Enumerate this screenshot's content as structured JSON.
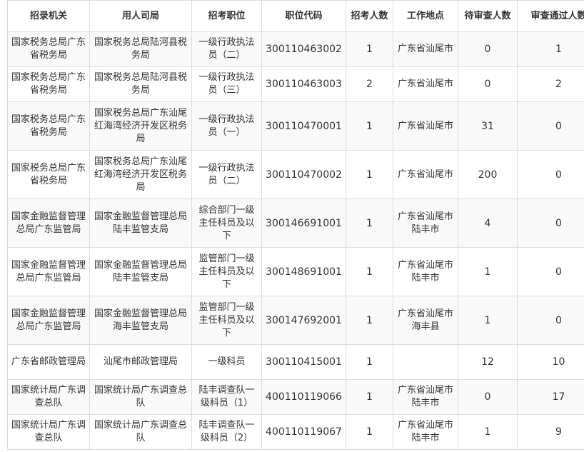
{
  "table": {
    "headers": [
      "招录机关",
      "用人司局",
      "招考职位",
      "职位代码",
      "招考人数",
      "工作地点",
      "待审查人数",
      "审查通过人数"
    ],
    "rows": [
      [
        "国家税务总局广东省税务局",
        "国家税务总局陆河县税务局",
        "一级行政执法员（二）",
        "300110463002",
        "1",
        "广东省汕尾市",
        "0",
        "1"
      ],
      [
        "国家税务总局广东省税务局",
        "国家税务总局陆河县税务局",
        "一级行政执法员（三）",
        "300110463003",
        "2",
        "广东省汕尾市",
        "0",
        "2"
      ],
      [
        "国家税务总局广东省税务局",
        "国家税务总局广东汕尾红海湾经济开发区税务局",
        "一级行政执法员（一）",
        "300110470001",
        "1",
        "广东省汕尾市",
        "31",
        "0"
      ],
      [
        "国家税务总局广东省税务局",
        "国家税务总局广东汕尾红海湾经济开发区税务局",
        "一级行政执法员（二）",
        "300110470002",
        "1",
        "广东省汕尾市",
        "200",
        "0"
      ],
      [
        "国家金融监督管理总局广东监管局",
        "国家金融监督管理总局陆丰监管支局",
        "综合部门一级主任科员及以下",
        "300146691001",
        "1",
        "广东省汕尾市陆丰市",
        "4",
        "0"
      ],
      [
        "国家金融监督管理总局广东监管局",
        "国家金融监督管理总局陆丰监管支局",
        "监管部门一级主任科员及以下",
        "300148691001",
        "1",
        "广东省汕尾市陆丰市",
        "1",
        "0"
      ],
      [
        "国家金融监督管理总局广东监管局",
        "国家金融监督管理总局海丰监管支局",
        "监管部门一级主任科员及以下",
        "300147692001",
        "1",
        "广东省汕尾市海丰县",
        "1",
        "0"
      ],
      [
        "广东省邮政管理局",
        "汕尾市邮政管理局",
        "一级科员",
        "300110415001",
        "1",
        "",
        "12",
        "10"
      ],
      [
        "国家统计局广东调查总队",
        "国家统计局广东调查总队",
        "陆丰调查队一级科员（1）",
        "400110119066",
        "1",
        "广东省汕尾市陆丰市",
        "0",
        "17"
      ],
      [
        "国家统计局广东调查总队",
        "国家统计局广东调查总队",
        "陆丰调查队一级科员（2）",
        "400110119067",
        "1",
        "广东省汕尾市陆丰市",
        "1",
        "9"
      ]
    ]
  }
}
